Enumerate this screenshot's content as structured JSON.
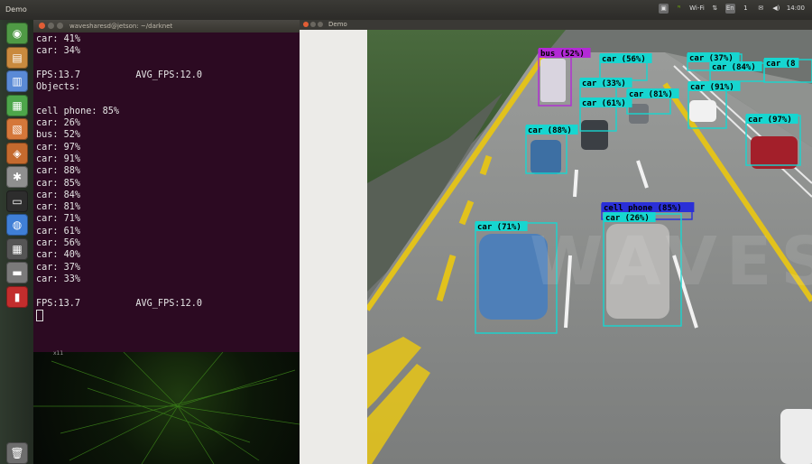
{
  "topbar": {
    "app_title": "Demo",
    "indicators": [
      "▣",
      "ᴺ",
      "Wi-Fi",
      "⇅",
      "En",
      "1",
      "✉",
      "◀)",
      "14:00"
    ]
  },
  "launcher": {
    "items": [
      {
        "icon": "ubuntu-dash-icon",
        "color": "#4f9a45"
      },
      {
        "icon": "files-icon",
        "color": "#c98a3e"
      },
      {
        "icon": "text-editor-icon",
        "color": "#5a8ad6"
      },
      {
        "icon": "spreadsheet-icon",
        "color": "#4da64a"
      },
      {
        "icon": "presentation-icon",
        "color": "#d5773a"
      },
      {
        "icon": "software-center-icon",
        "color": "#c46a2e"
      },
      {
        "icon": "system-settings-icon",
        "color": "#8f8f8f"
      },
      {
        "icon": "terminal-icon",
        "color": "#2d2d2d"
      },
      {
        "icon": "chromium-icon",
        "color": "#3f7fd6"
      },
      {
        "icon": "workspace-switcher-icon",
        "color": "#555555"
      },
      {
        "icon": "drive-icon",
        "color": "#7a7a7a"
      },
      {
        "icon": "app-icon",
        "color": "#c32d2d"
      },
      {
        "icon": "trash-icon",
        "color": "#6d6d6d"
      }
    ]
  },
  "terminal": {
    "title": "wavesharesd@jetson: ~/darknet",
    "lines": [
      "car: 41%",
      "car: 34%",
      "",
      "FPS:13.7          AVG_FPS:12.0",
      "Objects:",
      "",
      "cell phone: 85%",
      "car: 26%",
      "bus: 52%",
      "car: 97%",
      "car: 91%",
      "car: 88%",
      "car: 85%",
      "car: 84%",
      "car: 81%",
      "car: 71%",
      "car: 61%",
      "car: 56%",
      "car: 40%",
      "car: 37%",
      "car: 33%",
      "",
      "FPS:13.7          AVG_FPS:12.0"
    ]
  },
  "wallpaper_label": "x11",
  "demo": {
    "title": "Demo",
    "watermark": "WAVESHARE",
    "detections": [
      {
        "label": "bus (52%)",
        "color": "#b329d6"
      },
      {
        "label": "car (56%)",
        "color": "#17d6d0"
      },
      {
        "label": "car (37%)",
        "color": "#17d6d0"
      },
      {
        "label": "car (84%)",
        "color": "#17d6d0"
      },
      {
        "label": "car (8",
        "color": "#17d6d0"
      },
      {
        "label": "car (33%)",
        "color": "#17d6d0"
      },
      {
        "label": "car (61%)",
        "color": "#17d6d0"
      },
      {
        "label": "car (81%)",
        "color": "#17d6d0"
      },
      {
        "label": "car (91%)",
        "color": "#17d6d0"
      },
      {
        "label": "car (88%)",
        "color": "#17d6d0"
      },
      {
        "label": "car (97%)",
        "color": "#17d6d0"
      },
      {
        "label": "cell phone (85%)",
        "color": "#2a2fd8"
      },
      {
        "label": "car (26%)",
        "color": "#17d6d0"
      },
      {
        "label": "car (71%)",
        "color": "#17d6d0"
      }
    ]
  }
}
